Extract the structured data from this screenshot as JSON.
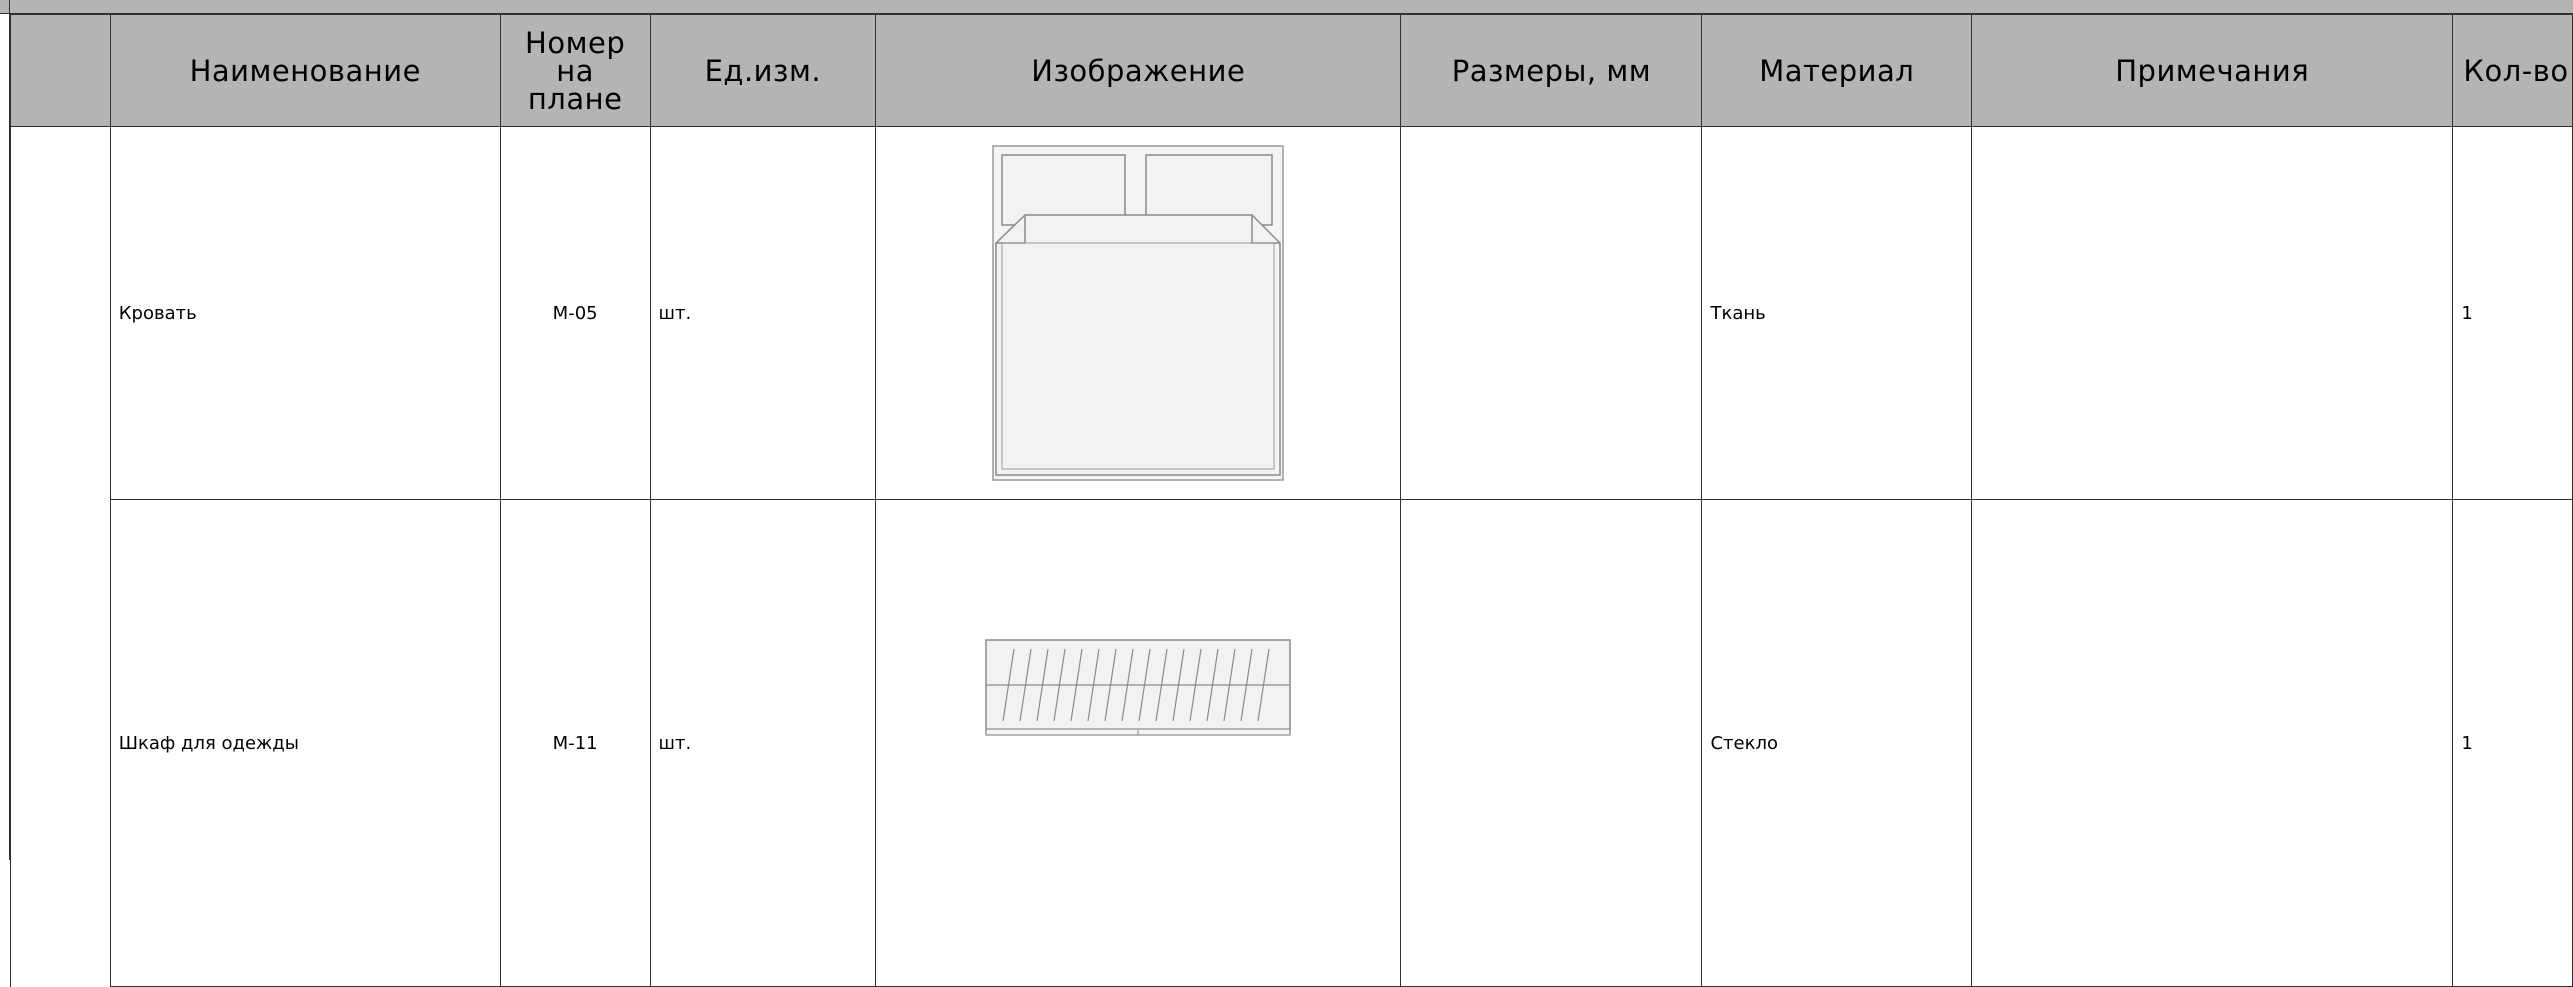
{
  "table": {
    "headers": {
      "name": "Наименование",
      "plan_no": "Номер на плане",
      "unit": "Ед.изм.",
      "image": "Изображение",
      "size": "Размеры, мм",
      "material": "Материал",
      "notes": "Примечания",
      "qty": "Кол-во"
    },
    "rows": [
      {
        "name": "Кровать",
        "plan_no": "М-05",
        "unit": "шт.",
        "image_icon": "bed-icon",
        "size": "",
        "material": "Ткань",
        "notes": "",
        "qty": "1"
      },
      {
        "name": "Шкаф для одежды",
        "plan_no": "М-11",
        "unit": "шт.",
        "image_icon": "wardrobe-icon",
        "size": "",
        "material": "Стекло",
        "notes": "",
        "qty": "1"
      }
    ]
  },
  "colors": {
    "header_bg": "#b4b4b4",
    "grid_line": "#303030",
    "drawing_fill": "#f2f2f2",
    "drawing_line": "#8a8a8a"
  }
}
